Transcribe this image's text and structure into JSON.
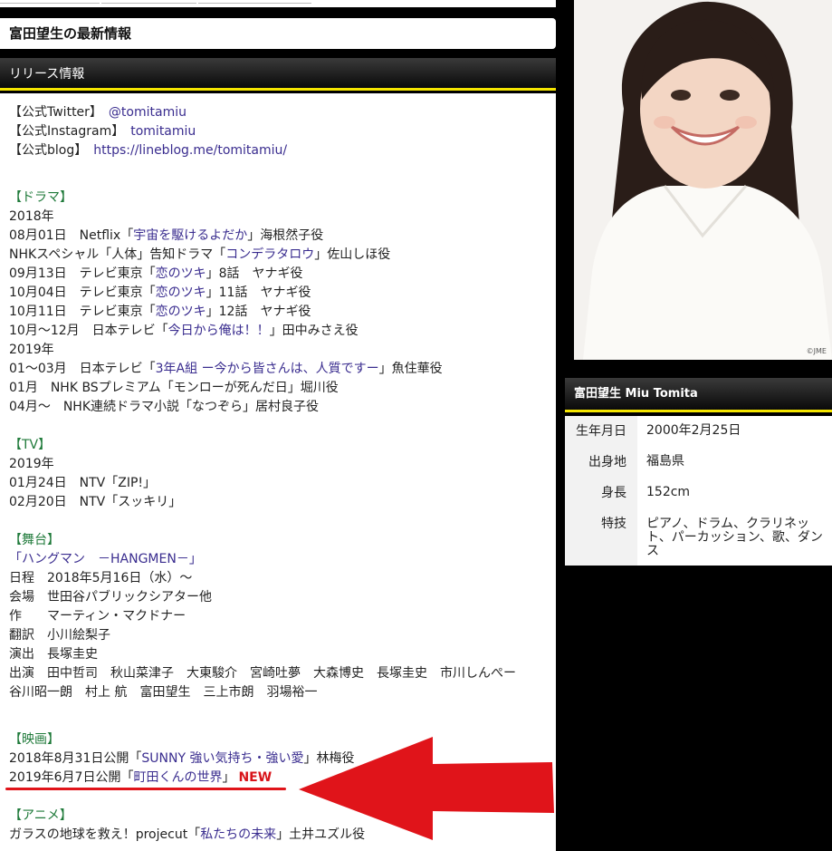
{
  "page_title": "富田望生の最新情報",
  "release_header": "リリース情報",
  "social": [
    {
      "label": "【公式Twitter】",
      "link": "@tomitamiu"
    },
    {
      "label": "【公式Instagram】",
      "link": "tomitamiu"
    },
    {
      "label": "【公式blog】",
      "link": "https://lineblog.me/tomitamiu/"
    }
  ],
  "drama": {
    "title": "【ドラマ】",
    "year1": "2018年",
    "items2018": [
      {
        "pre": "08月01日　Netflix「",
        "link": "宇宙を駆けるよだか",
        "post": "」海根然子役"
      },
      {
        "pre": "NHKスペシャル「人体」告知ドラマ「",
        "link": "コンデラタロウ",
        "post": "」佐山しほ役"
      },
      {
        "pre": "09月13日　テレビ東京「",
        "link": "恋のツキ",
        "post": "」8話　ヤナギ役"
      },
      {
        "pre": "10月04日　テレビ東京「",
        "link": "恋のツキ",
        "post": "」11話　ヤナギ役"
      },
      {
        "pre": "10月11日　テレビ東京「",
        "link": "恋のツキ",
        "post": "」12話　ヤナギ役"
      },
      {
        "pre": "10月～12月　日本テレビ「",
        "link": "今日から俺は！！",
        "post": "」田中みさえ役"
      }
    ],
    "year2": "2019年",
    "items2019": [
      {
        "pre": "01～03月　日本テレビ「",
        "link": "3年A組 ー今から皆さんは、人質ですー",
        "post": "」魚住華役"
      },
      {
        "pre": "01月　NHK BSプレミアム「モンローが死んだ日」堀川役",
        "link": "",
        "post": ""
      },
      {
        "pre": "04月～　NHK連続ドラマ小説「なつぞら」居村良子役",
        "link": "",
        "post": ""
      }
    ]
  },
  "tv": {
    "title": "【TV】",
    "year": "2019年",
    "items": [
      "01月24日　NTV「ZIP!」",
      "02月20日　NTV「スッキリ」"
    ]
  },
  "stage": {
    "title": "【舞台】",
    "link": "「ハングマン　－HANGMEN－」",
    "lines": [
      "日程　2018年5月16日（水）～",
      "会場　世田谷パブリックシアター他",
      "作　　マーティン・マクドナー",
      "翻訳　小川絵梨子",
      "演出　長塚圭史",
      "出演　田中哲司　秋山菜津子　大東駿介　宮崎吐夢　大森博史　長塚圭史　市川しんぺー",
      "谷川昭一朗　村上 航　富田望生　三上市朗　羽場裕一"
    ]
  },
  "movie": {
    "title": "【映画】",
    "items": [
      {
        "pre": "2018年8月31日公開「",
        "link": "SUNNY 強い気持ち・強い愛",
        "post": "」林梅役",
        "badge": ""
      },
      {
        "pre": "2019年6月7日公開「",
        "link": "町田くんの世界",
        "post": "」",
        "badge": "NEW"
      }
    ]
  },
  "anime": {
    "title": "【アニメ】",
    "line_pre": "ガラスの地球を救え！projecut「",
    "line_link": "私たちの未来",
    "line_post": "」土井ユズル役"
  },
  "photo_credit": "©JME",
  "profile": {
    "header": "富田望生  Miu Tomita",
    "rows": [
      {
        "label": "生年月日",
        "value": "2000年2月25日"
      },
      {
        "label": "出身地",
        "value": "福島県"
      },
      {
        "label": "身長",
        "value": "152cm"
      },
      {
        "label": "特技",
        "value": "ピアノ、ドラム、クラリネット、パーカッション、歌、ダンス"
      }
    ]
  },
  "colors": {
    "accent_yellow": "#f5e500",
    "link": "#3a2d8f",
    "section_green": "#1f7a3a",
    "new_red": "#d8141a",
    "arrow_red": "#e0141a"
  }
}
